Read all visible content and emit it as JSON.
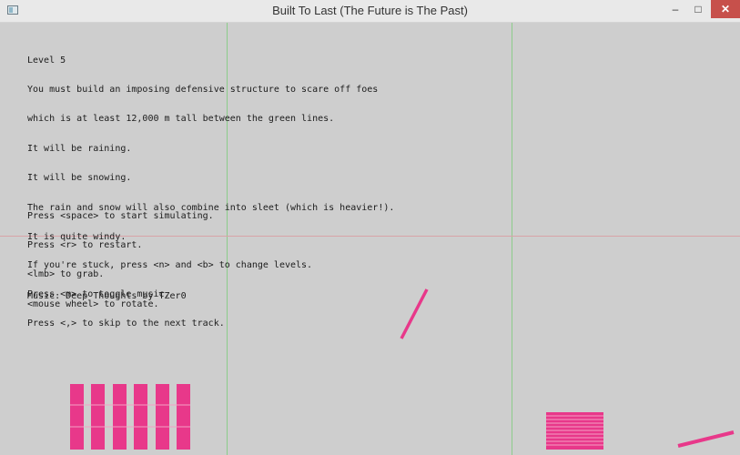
{
  "window": {
    "title": "Built To Last (The Future is The Past)",
    "minimize_glyph": "–",
    "maximize_glyph": "□",
    "close_glyph": "✕",
    "icon": "app-window-icon"
  },
  "info_lines": [
    "Level 5",
    "You must build an imposing defensive structure to scare off foes",
    "which is at least 12,000 m tall between the green lines.",
    "It will be raining.",
    "It will be snowing.",
    "The rain and snow will also combine into sleet (which is heavier!).",
    "It is quite windy.",
    "",
    "Music: Deep Thoughts by TZer0"
  ],
  "control_lines": [
    "Press <space> to start simulating.",
    "Press <r> to restart.",
    "<lmb> to grab.",
    "<mouse wheel> to rotate."
  ],
  "help_lines": [
    "If you're stuck, press <n> and <b> to change levels.",
    "Press <m> to toggle music.",
    "Press <,> to skip to the next track."
  ],
  "colors": {
    "background": "#cecece",
    "block": "#e8388a",
    "goal_lines": "#8ccc8a",
    "height_line": "#d8a3a8"
  }
}
